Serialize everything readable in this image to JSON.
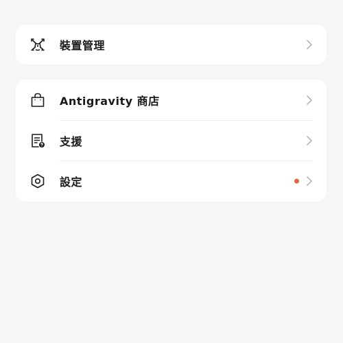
{
  "device_section": {
    "label": "裝置管理",
    "icon": "drone-icon"
  },
  "menu_section": {
    "items": [
      {
        "label": "Antigravity 商店",
        "icon": "shopping-bag-icon"
      },
      {
        "label": "支援",
        "icon": "support-document-icon"
      },
      {
        "label": "設定",
        "icon": "settings-hexagon-icon",
        "has_notification_dot": true
      }
    ]
  },
  "colors": {
    "background": "#f6f6f6",
    "card": "#ffffff",
    "text": "#1a1a1a",
    "chevron": "#b5b5b5",
    "notification_dot": "#e0643f"
  }
}
